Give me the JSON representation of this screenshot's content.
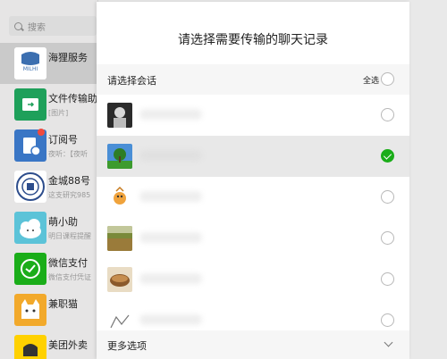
{
  "sidebar": {
    "search_placeholder": "搜索",
    "chats": [
      {
        "name": "海狸服务",
        "subtitle": "",
        "icon": "beaver-logo-icon"
      },
      {
        "name": "文件传输助",
        "subtitle": "[图片]",
        "icon": "file-transfer-icon"
      },
      {
        "name": "订阅号",
        "subtitle": "夜听：【夜听",
        "icon": "subscription-icon"
      },
      {
        "name": "金城88号",
        "subtitle": "这支研究985",
        "icon": "school-seal-icon"
      },
      {
        "name": "萌小助",
        "subtitle": "明日课程提醒",
        "icon": "cloud-mascot-icon"
      },
      {
        "name": "微信支付",
        "subtitle": "微信支付凭证",
        "icon": "wechat-pay-icon"
      },
      {
        "name": "兼职猫",
        "subtitle": "",
        "icon": "cat-icon"
      },
      {
        "name": "美团外卖",
        "subtitle": "",
        "icon": "meituan-icon"
      }
    ]
  },
  "dialog": {
    "title": "请选择需要传输的聊天记录",
    "select_label": "请选择会话",
    "select_all_label": "全选",
    "more_options_label": "更多选项"
  },
  "conversations": [
    {
      "selected": false,
      "thumb": "portrait-avatar"
    },
    {
      "selected": true,
      "thumb": "tree-landscape-avatar"
    },
    {
      "selected": false,
      "thumb": "cartoon-avatar"
    },
    {
      "selected": false,
      "thumb": "field-avatar"
    },
    {
      "selected": false,
      "thumb": "food-avatar"
    },
    {
      "selected": false,
      "thumb": "sketch-avatar"
    }
  ],
  "colors": {
    "accent": "#1aad19",
    "badge": "#f04a3e"
  }
}
